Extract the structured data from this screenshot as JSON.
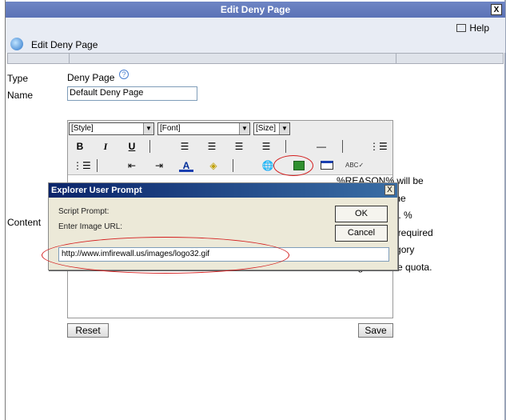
{
  "window": {
    "title": "Edit Deny Page",
    "close_label": "X"
  },
  "toolbar": {
    "help_label": "Help",
    "page_heading": "Edit Deny Page"
  },
  "form": {
    "type_label": "Type",
    "type_value": "Deny Page",
    "help_glyph": "?",
    "name_label": "Name",
    "name_value": "Default Deny Page",
    "content_label": "Content"
  },
  "editor": {
    "style_select": "[Style]",
    "font_select": "[Font]",
    "size_select": "[Size]",
    "bold": "B",
    "italic": "I",
    "underline": "U",
    "body_lines": [
      "%REASON% will be",
      "eplaced with the",
      "locking reason. %",
      "REASON% is required",
      "r website category",
      "raning and time quota."
    ],
    "reset_label": "Reset",
    "save_label": "Save"
  },
  "dialog": {
    "title": "Explorer User Prompt",
    "close_label": "X",
    "script_prompt_label": "Script Prompt:",
    "enter_url_label": "Enter Image URL:",
    "ok_label": "OK",
    "cancel_label": "Cancel",
    "url_value": "http://www.imfirewall.us/images/logo32.gif"
  },
  "colors": {
    "titlebar": "#5a72b6",
    "dialog_titlebar": "#0a246a",
    "annotation": "#d41e1e"
  }
}
